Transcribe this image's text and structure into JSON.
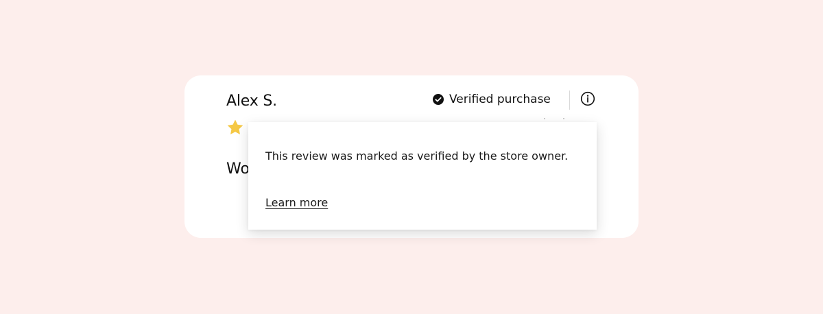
{
  "review": {
    "reviewer_name": "Alex S.",
    "rating": 1,
    "rating_max": 5,
    "title_partial": "Wo",
    "star_icon": "star-icon",
    "star_color": "#f5c845"
  },
  "verification": {
    "label": "Verified purchase",
    "check_icon": "check-circle-icon",
    "info_icon": "info-icon"
  },
  "tooltip": {
    "text": "This review was marked as verified by the store owner.",
    "link_label": "Learn more"
  },
  "colors": {
    "background": "#fdeeec",
    "card": "#ffffff",
    "text": "#111111"
  }
}
